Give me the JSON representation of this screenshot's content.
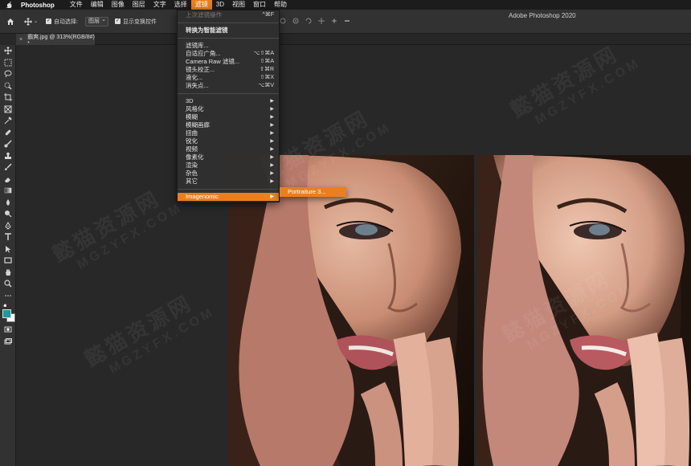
{
  "menubar": {
    "app_name": "Photoshop",
    "items": [
      "文件",
      "编辑",
      "图像",
      "图层",
      "文字",
      "选择",
      "滤镜",
      "3D",
      "视图",
      "窗口",
      "帮助"
    ],
    "active_index": 6
  },
  "window": {
    "title": "Adobe Photoshop 2020"
  },
  "options": {
    "auto_select_label": "自动选择:",
    "auto_select_value": "图层",
    "show_transform_label": "显示变换控件"
  },
  "document_tab": {
    "title": "霸爽.jpg @ 313%(RGB/8#) *"
  },
  "filter_menu": {
    "last_filter": {
      "label": "上次滤镜操作",
      "shortcut": "^⌘F"
    },
    "convert_smart": {
      "label": "转换为智能滤镜"
    },
    "group1": [
      {
        "label": "滤镜库...",
        "shortcut": ""
      },
      {
        "label": "自适应广角...",
        "shortcut": "⌥⇧⌘A"
      },
      {
        "label": "Camera Raw 滤镜...",
        "shortcut": "⇧⌘A"
      },
      {
        "label": "镜头校正...",
        "shortcut": "⇧⌘R"
      },
      {
        "label": "液化...",
        "shortcut": "⇧⌘X"
      },
      {
        "label": "消失点...",
        "shortcut": "⌥⌘V"
      }
    ],
    "group2": [
      {
        "label": "3D"
      },
      {
        "label": "风格化"
      },
      {
        "label": "模糊"
      },
      {
        "label": "模糊画廊"
      },
      {
        "label": "扭曲"
      },
      {
        "label": "锐化"
      },
      {
        "label": "视频"
      },
      {
        "label": "像素化"
      },
      {
        "label": "渲染"
      },
      {
        "label": "杂色"
      },
      {
        "label": "其它"
      }
    ],
    "imagenomic": {
      "label": "Imagenomic"
    }
  },
  "submenu": {
    "label": "Portraiture 3..."
  },
  "watermark": {
    "cn": "懿猫资源网",
    "en": "MGZYFX.COM"
  },
  "colors": {
    "accent": "#e8801f",
    "foreground_swatch": "#1a9a9a",
    "background_swatch": "#ffffff"
  }
}
